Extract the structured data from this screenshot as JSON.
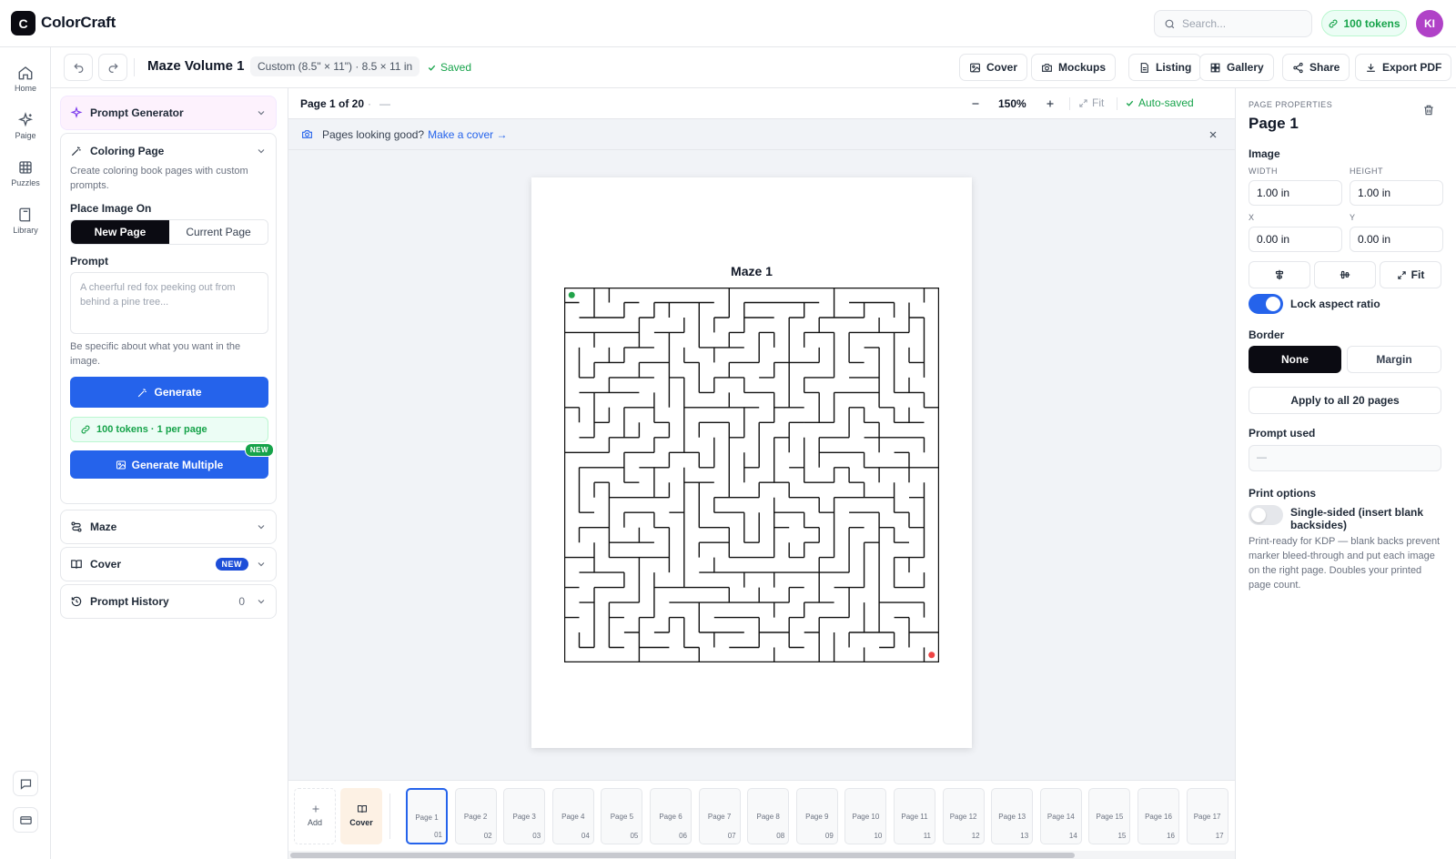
{
  "app": {
    "logo_letter": "C",
    "name": "ColorCraft"
  },
  "header": {
    "search_placeholder": "Search...",
    "tokens_label": "100 tokens",
    "avatar_initials": "KI"
  },
  "rail": {
    "items": [
      {
        "label": "Home",
        "icon": "home-icon"
      },
      {
        "label": "Paige",
        "icon": "sparkle-icon"
      },
      {
        "label": "Puzzles",
        "icon": "grid-icon"
      },
      {
        "label": "Library",
        "icon": "book-icon"
      }
    ],
    "bottom_icons": [
      "chat-icon",
      "card-icon"
    ]
  },
  "toolbar": {
    "title": "Maze Volume 1",
    "size_chip": "Custom (8.5\" × 11\") · 8.5 × 11 in",
    "saved_label": "Saved",
    "buttons": [
      {
        "label": "Cover",
        "icon": "image-icon"
      },
      {
        "label": "Mockups",
        "icon": "camera-icon"
      },
      {
        "label": "Listing",
        "icon": "document-icon"
      },
      {
        "label": "Gallery",
        "icon": "gallery-grid-icon"
      },
      {
        "label": "Share",
        "icon": "share-icon"
      },
      {
        "label": "Export PDF",
        "icon": "download-icon"
      }
    ]
  },
  "left_panel": {
    "prompt_generator": {
      "title": "Prompt Generator"
    },
    "coloring_page": {
      "title": "Coloring Page",
      "description": "Create coloring book pages with custom prompts.",
      "place_label": "Place Image On",
      "place_options": [
        "New Page",
        "Current Page"
      ],
      "place_selected": "New Page",
      "prompt_label": "Prompt",
      "prompt_placeholder": "A cheerful red fox peeking out from behind a pine tree...",
      "hint": "Be specific about what you want in the image.",
      "generate_label": "Generate",
      "token_info": "100 tokens · 1 per page",
      "generate_multiple_label": "Generate Multiple",
      "new_badge": "NEW"
    },
    "maze": {
      "title": "Maze"
    },
    "cover": {
      "title": "Cover",
      "badge": "NEW"
    },
    "prompt_history": {
      "title": "Prompt History",
      "count": "0"
    }
  },
  "canvas": {
    "page_indicator": "Page 1 of 20",
    "page_sep": "·",
    "page_dash": "—",
    "zoom": "150%",
    "fit_label": "Fit",
    "autosaved_label": "Auto-saved",
    "notice_text": "Pages looking good?",
    "notice_link": "Make a cover →",
    "maze_title": "Maze 1",
    "start_color": "#22a34a",
    "end_color": "#ef4444"
  },
  "filmstrip": {
    "add_label": "Add",
    "cover_label": "Cover",
    "pages": [
      {
        "name": "Page 1",
        "num": "01"
      },
      {
        "name": "Page 2",
        "num": "02"
      },
      {
        "name": "Page 3",
        "num": "03"
      },
      {
        "name": "Page 4",
        "num": "04"
      },
      {
        "name": "Page 5",
        "num": "05"
      },
      {
        "name": "Page 6",
        "num": "06"
      },
      {
        "name": "Page 7",
        "num": "07"
      },
      {
        "name": "Page 8",
        "num": "08"
      },
      {
        "name": "Page 9",
        "num": "09"
      },
      {
        "name": "Page 10",
        "num": "10"
      },
      {
        "name": "Page 11",
        "num": "11"
      },
      {
        "name": "Page 12",
        "num": "12"
      },
      {
        "name": "Page 13",
        "num": "13"
      },
      {
        "name": "Page 14",
        "num": "14"
      },
      {
        "name": "Page 15",
        "num": "15"
      },
      {
        "name": "Page 16",
        "num": "16"
      },
      {
        "name": "Page 17",
        "num": "17"
      }
    ],
    "active_page": "Page 1"
  },
  "right_panel": {
    "section_label": "PAGE PROPERTIES",
    "page_title": "Page 1",
    "image_label": "Image",
    "width_label": "WIDTH",
    "height_label": "HEIGHT",
    "width_value": "1.00 in",
    "height_value": "1.00 in",
    "x_label": "X",
    "y_label": "Y",
    "x_value": "0.00 in",
    "y_value": "0.00 in",
    "fit_label": "Fit",
    "lock_aspect_label": "Lock aspect ratio",
    "lock_aspect_on": true,
    "border_label": "Border",
    "border_options": [
      "None",
      "Margin"
    ],
    "border_selected": "None",
    "apply_all_label": "Apply to all 20 pages",
    "prompt_used_label": "Prompt used",
    "prompt_used_value": "—",
    "print_options_label": "Print options",
    "single_sided_label": "Single-sided (insert blank backsides)",
    "single_sided_on": false,
    "print_help": "Print-ready for KDP — blank backs prevent marker bleed-through and put each image on the right page. Doubles your printed page count."
  }
}
